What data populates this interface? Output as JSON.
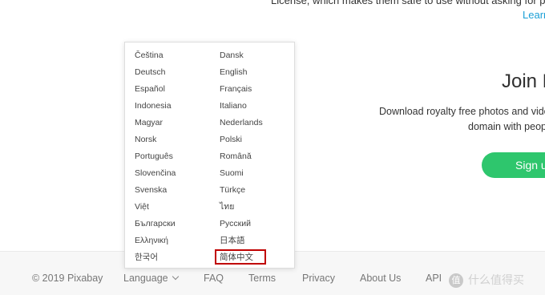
{
  "hero": {
    "top_text": "License, which makes them safe to use without asking for permi",
    "learn_link": "Learn",
    "join_heading": "Join P",
    "desc_line1": "Download royalty free photos and vide",
    "desc_line2": "domain with peop",
    "signup_label": "Sign up"
  },
  "languages": [
    "Čeština",
    "Dansk",
    "Deutsch",
    "English",
    "Español",
    "Français",
    "Indonesia",
    "Italiano",
    "Magyar",
    "Nederlands",
    "Norsk",
    "Polski",
    "Português",
    "Română",
    "Slovenčina",
    "Suomi",
    "Svenska",
    "Türkçe",
    "Việt",
    "ไทย",
    "Български",
    "Русский",
    "Ελληνική",
    "日本語",
    "한국어",
    "简体中文"
  ],
  "highlighted_language": "简体中文",
  "highlight_color": "#c00000",
  "accent_color": "#2ec66d",
  "footer": {
    "copyright": "© 2019 Pixabay",
    "language": "Language",
    "faq": "FAQ",
    "terms": "Terms",
    "privacy": "Privacy",
    "about": "About Us",
    "api": "API"
  },
  "watermark": {
    "badge": "值",
    "text": "什么值得买"
  }
}
